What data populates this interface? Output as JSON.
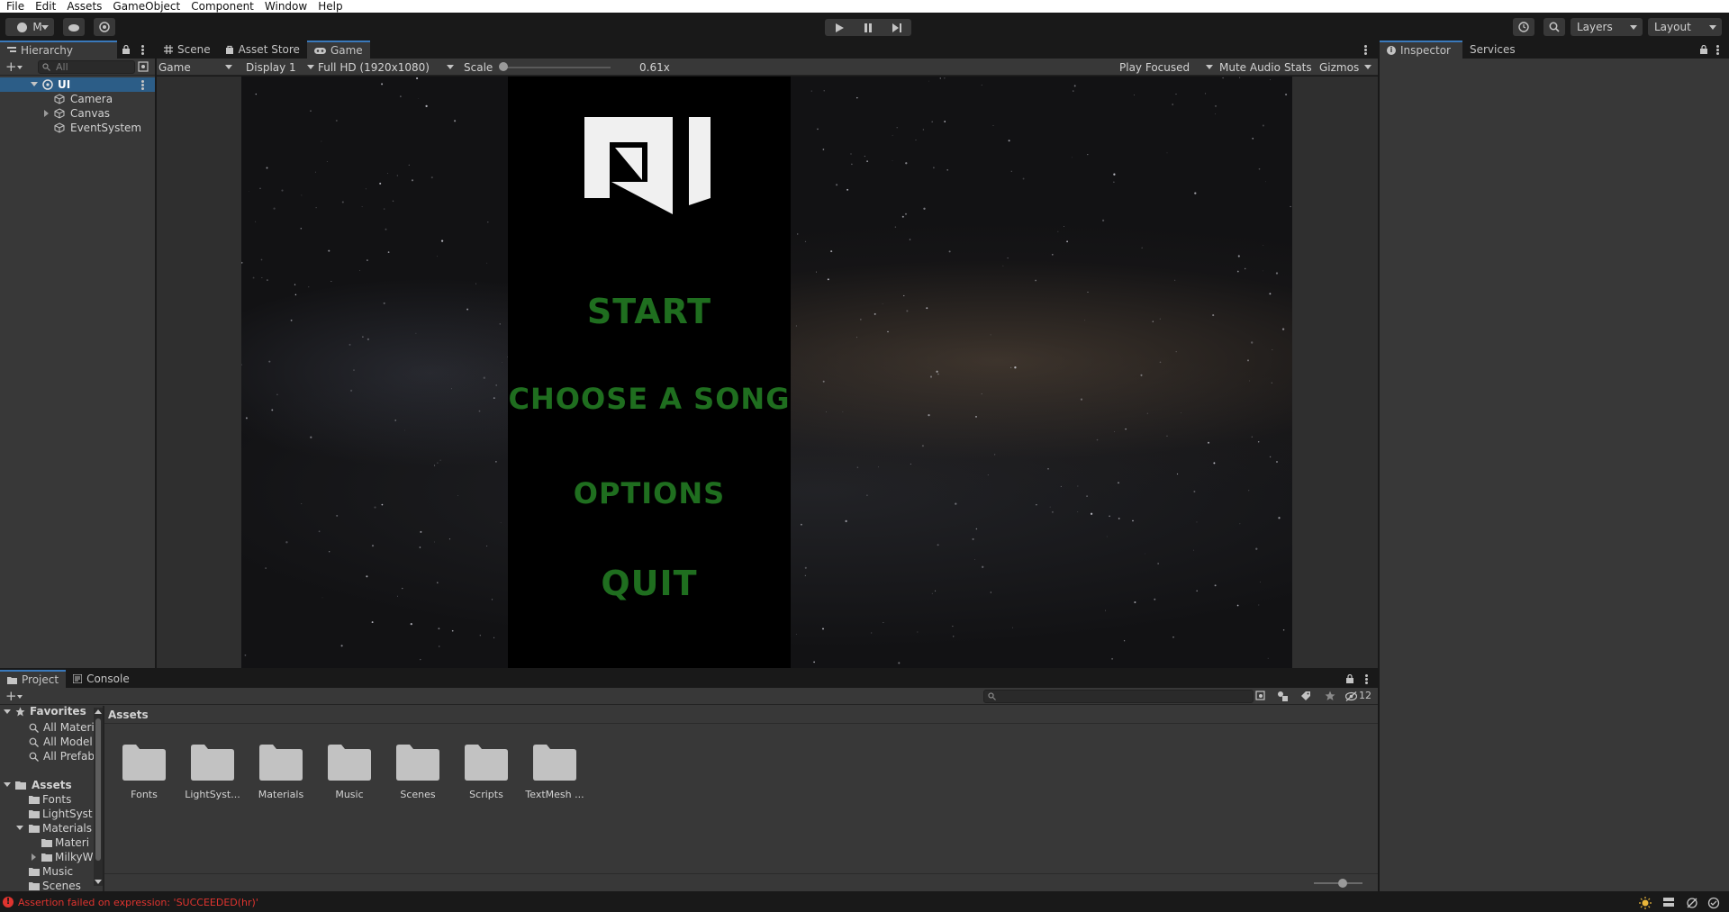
{
  "menu": [
    "File",
    "Edit",
    "Assets",
    "GameObject",
    "Component",
    "Window",
    "Help"
  ],
  "toolbar": {
    "account_label": "M",
    "layers_label": "Layers",
    "layout_label": "Layout"
  },
  "hierarchy": {
    "tab_label": "Hierarchy",
    "search_placeholder": "All",
    "scene_name": "UI",
    "items": [
      "Camera",
      "Canvas",
      "EventSystem"
    ]
  },
  "center_tabs": [
    "Scene",
    "Asset Store",
    "Game"
  ],
  "game_toolbar": {
    "view_mode": "Game",
    "display": "Display 1",
    "resolution": "Full HD (1920x1080)",
    "scale_label": "Scale",
    "scale_value": "0.61x",
    "scale_fraction": 0.0,
    "play_focused": "Play Focused",
    "mute_audio": "Mute Audio",
    "stats": "Stats",
    "gizmos": "Gizmos"
  },
  "game_menu": {
    "start": "START",
    "choose_song": "CHOOSE A SONG",
    "options": "OPTIONS",
    "quit": "QUIT",
    "button_color": "#1f6e1f"
  },
  "right_tabs": [
    "Inspector",
    "Services"
  ],
  "bottom_tabs": [
    "Project",
    "Console"
  ],
  "project": {
    "hidden_count": "12",
    "favorites_label": "Favorites",
    "favorites": [
      "All Materi",
      "All Model",
      "All Prefab"
    ],
    "assets_label": "Assets",
    "tree": [
      "Fonts",
      "LightSyst",
      "Materials",
      "Materi",
      "MilkyW",
      "Music",
      "Scenes"
    ],
    "breadcrumb": "Assets",
    "folders": [
      "Fonts",
      "LightSyst...",
      "Materials",
      "Music",
      "Scenes",
      "Scripts",
      "TextMesh ..."
    ]
  },
  "status": {
    "message": "Assertion failed on expression: 'SUCCEEDED(hr)'",
    "error_color": "#e0342f"
  },
  "colors": {
    "accent": "#3a79bb",
    "panel": "#383838",
    "dark": "#191919"
  }
}
